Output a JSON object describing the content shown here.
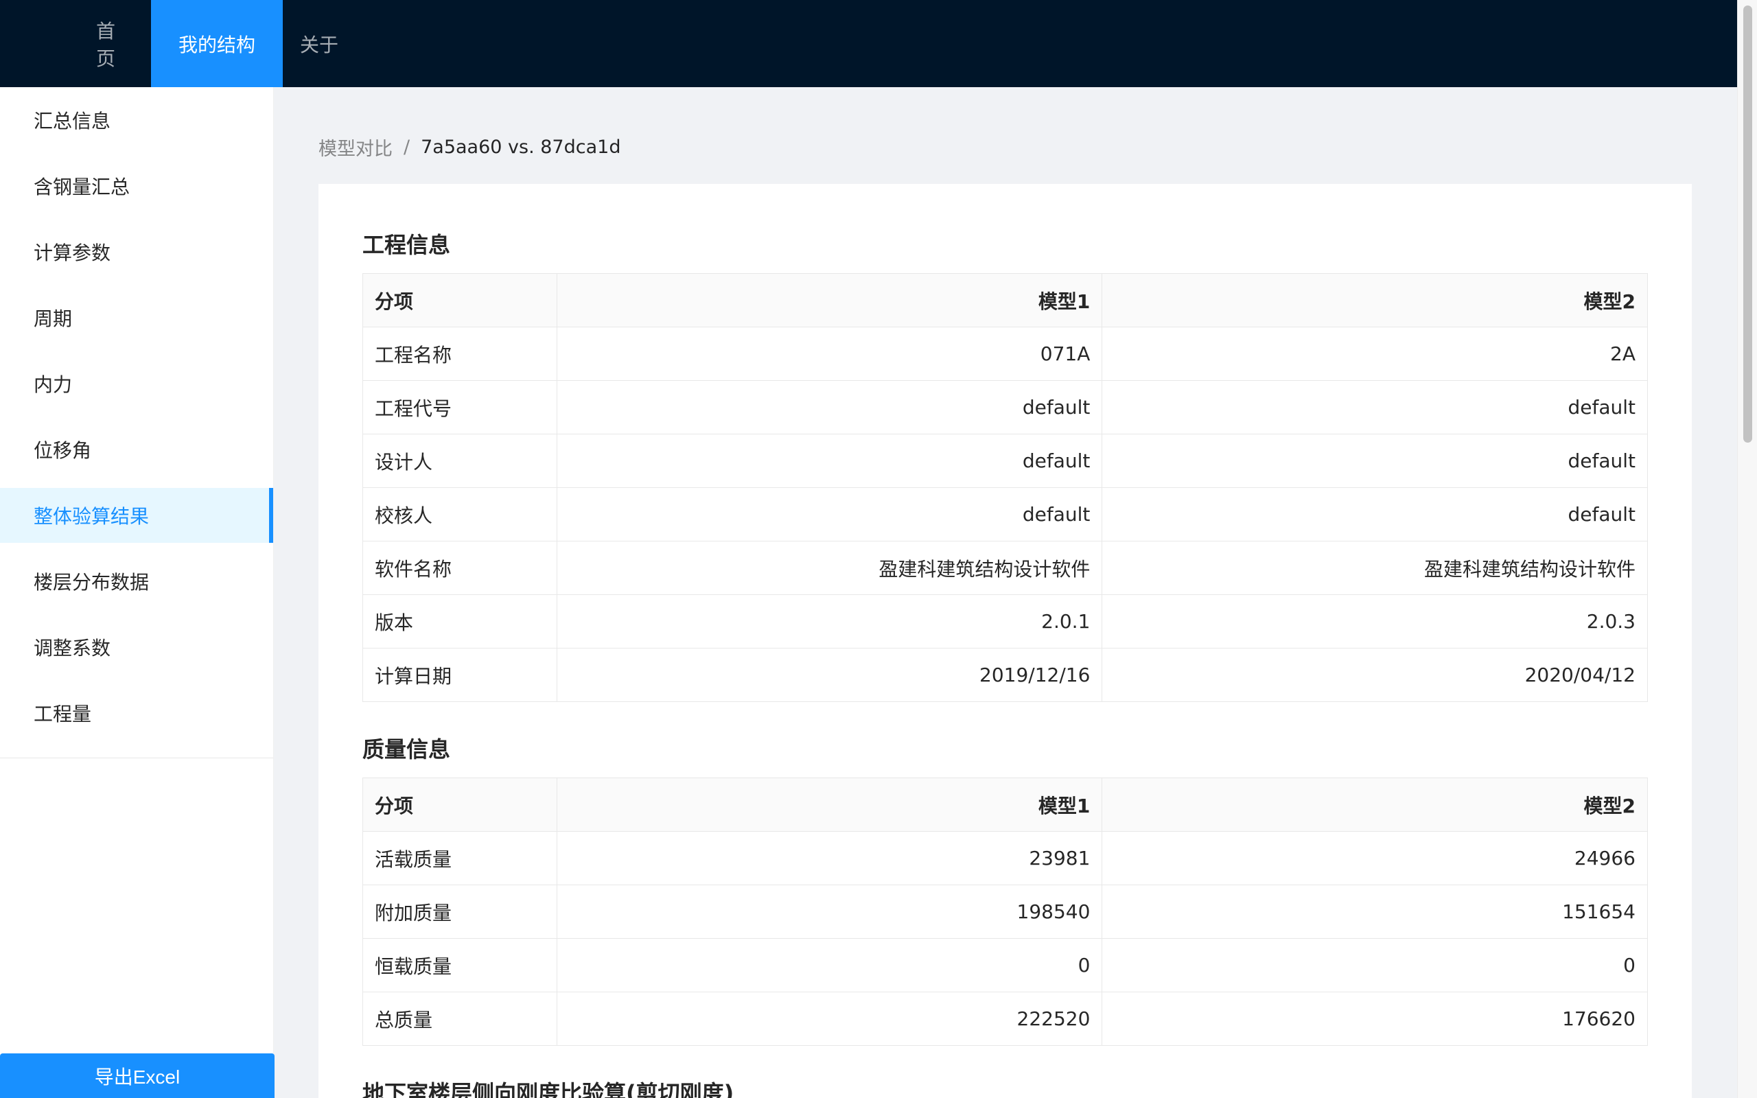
{
  "nav": {
    "items": [
      {
        "label": "首页"
      },
      {
        "label": "我的结构"
      },
      {
        "label": "关于"
      }
    ]
  },
  "sidebar": {
    "items": [
      {
        "label": "汇总信息"
      },
      {
        "label": "含钢量汇总"
      },
      {
        "label": "计算参数"
      },
      {
        "label": "周期"
      },
      {
        "label": "内力"
      },
      {
        "label": "位移角"
      },
      {
        "label": "整体验算结果"
      },
      {
        "label": "楼层分布数据"
      },
      {
        "label": "调整系数"
      },
      {
        "label": "工程量"
      }
    ],
    "active_index": 6,
    "export_label": "导出Excel"
  },
  "breadcrumb": {
    "parent": "模型对比",
    "separator": "/",
    "current": "7a5aa60 vs. 87dca1d"
  },
  "sections": {
    "project": {
      "title": "工程信息",
      "headers": [
        "分项",
        "模型1",
        "模型2"
      ],
      "rows": [
        [
          "工程名称",
          "071A",
          "2A"
        ],
        [
          "工程代号",
          "default",
          "default"
        ],
        [
          "设计人",
          "default",
          "default"
        ],
        [
          "校核人",
          "default",
          "default"
        ],
        [
          "软件名称",
          "盈建科建筑结构设计软件",
          "盈建科建筑结构设计软件"
        ],
        [
          "版本",
          "2.0.1",
          "2.0.3"
        ],
        [
          "计算日期",
          "2019/12/16",
          "2020/04/12"
        ]
      ]
    },
    "mass": {
      "title": "质量信息",
      "headers": [
        "分项",
        "模型1",
        "模型2"
      ],
      "rows": [
        [
          "活载质量",
          "23981",
          "24966"
        ],
        [
          "附加质量",
          "198540",
          "151654"
        ],
        [
          "恒载质量",
          "0",
          "0"
        ],
        [
          "总质量",
          "222520",
          "176620"
        ]
      ]
    },
    "basement": {
      "title": "地下室楼层侧向刚度比验算(剪切刚度)"
    }
  },
  "colors": {
    "header_bg": "#001529",
    "accent": "#1890ff",
    "active_menu_bg": "#e6f7ff"
  }
}
